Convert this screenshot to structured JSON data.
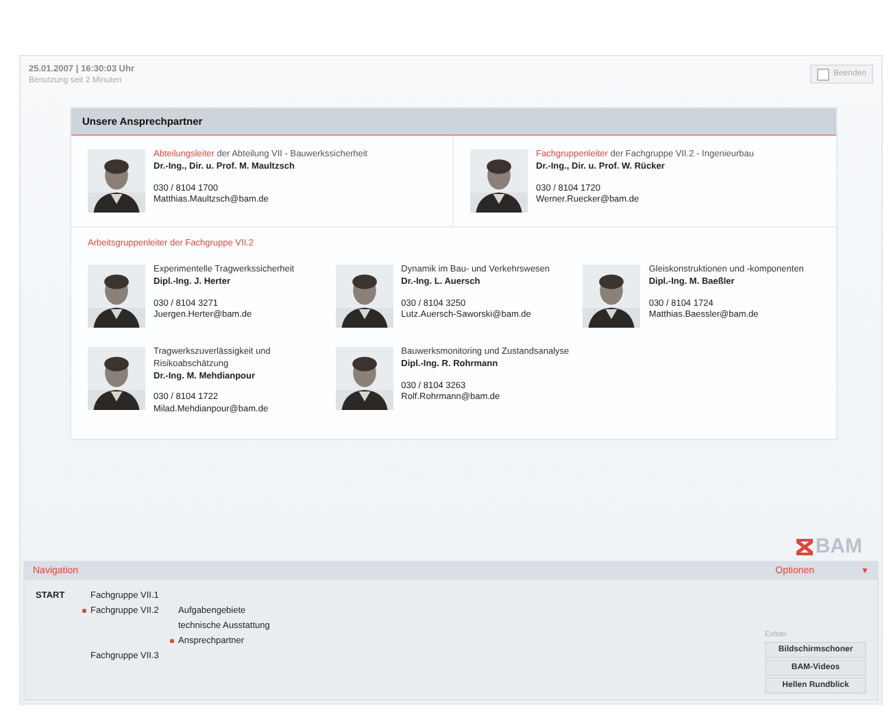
{
  "header": {
    "datetime": "25.01.2007 | 16:30:03 Uhr",
    "session": "Benutzung seit 2 Minuten",
    "exit_button": "Beenden"
  },
  "panel": {
    "title": "Unsere Ansprechpartner",
    "leaders": [
      {
        "role": "Abteilungsleiter",
        "unit": " der Abteilung VII - Bauwerkssicherheit",
        "name": "Dr.-Ing., Dir. u. Prof. M. Maultzsch",
        "phone": "030 / 8104 1700",
        "email": "Matthias.Maultzsch@bam.de"
      },
      {
        "role": "Fachgruppenleiter",
        "unit": " der Fachgruppe VII.2 - Ingenieurbau",
        "name": "Dr.-Ing., Dir. u. Prof. W. Rücker",
        "phone": "030 / 8104 1720",
        "email": "Werner.Ruecker@bam.de"
      }
    ],
    "group_heading": "Arbeitsgruppenleiter der Fachgruppe VII.2",
    "groups": [
      {
        "topic": "Experimentelle Tragwerkssicherheit",
        "name": "Dipl.-Ing. J. Herter",
        "phone": "030 / 8104 3271",
        "email": "Juergen.Herter@bam.de"
      },
      {
        "topic": "Dynamik im Bau- und Verkehrswesen",
        "name": "Dr.-Ing. L. Auersch",
        "phone": "030 / 8104 3250",
        "email": "Lutz.Auersch-Saworski@bam.de"
      },
      {
        "topic": "Gleiskonstruktionen und -komponenten",
        "name": "Dipl.-Ing. M. Baeßler",
        "phone": "030 / 8104 1724",
        "email": "Matthias.Baessler@bam.de"
      },
      {
        "topic": "Tragwerkszuverlässigkeit und Risikoabschätzung",
        "name": "Dr.-Ing. M. Mehdianpour",
        "phone": "030 / 8104 1722",
        "email": "Milad.Mehdianpour@bam.de"
      },
      {
        "topic": "Bauwerksmonitoring und Zustandsanalyse",
        "name": "Dipl.-Ing. R. Rohrmann",
        "phone": "030 / 8104 3263",
        "email": "Rolf.Rohrmann@bam.de"
      }
    ]
  },
  "logo": "BAM",
  "navigation": {
    "title": "Navigation",
    "options_label": "Optionen",
    "options_toggle": "▼",
    "tree": [
      {
        "label": "START",
        "selected": false,
        "children": [
          {
            "label": "Fachgruppe VII.1",
            "selected": false
          },
          {
            "label": "Fachgruppe VII.2",
            "selected": true,
            "children": [
              {
                "label": "Aufgabengebiete",
                "selected": false
              },
              {
                "label": "technische Ausstattung",
                "selected": false
              },
              {
                "label": "Ansprechpartner",
                "selected": true
              }
            ]
          },
          {
            "label": "Fachgruppe VII.3",
            "selected": false
          }
        ]
      }
    ],
    "extras_label": "Extras",
    "extras": [
      "Bildschirmschoner",
      "BAM-Videos",
      "Hellen Rundblick"
    ]
  }
}
